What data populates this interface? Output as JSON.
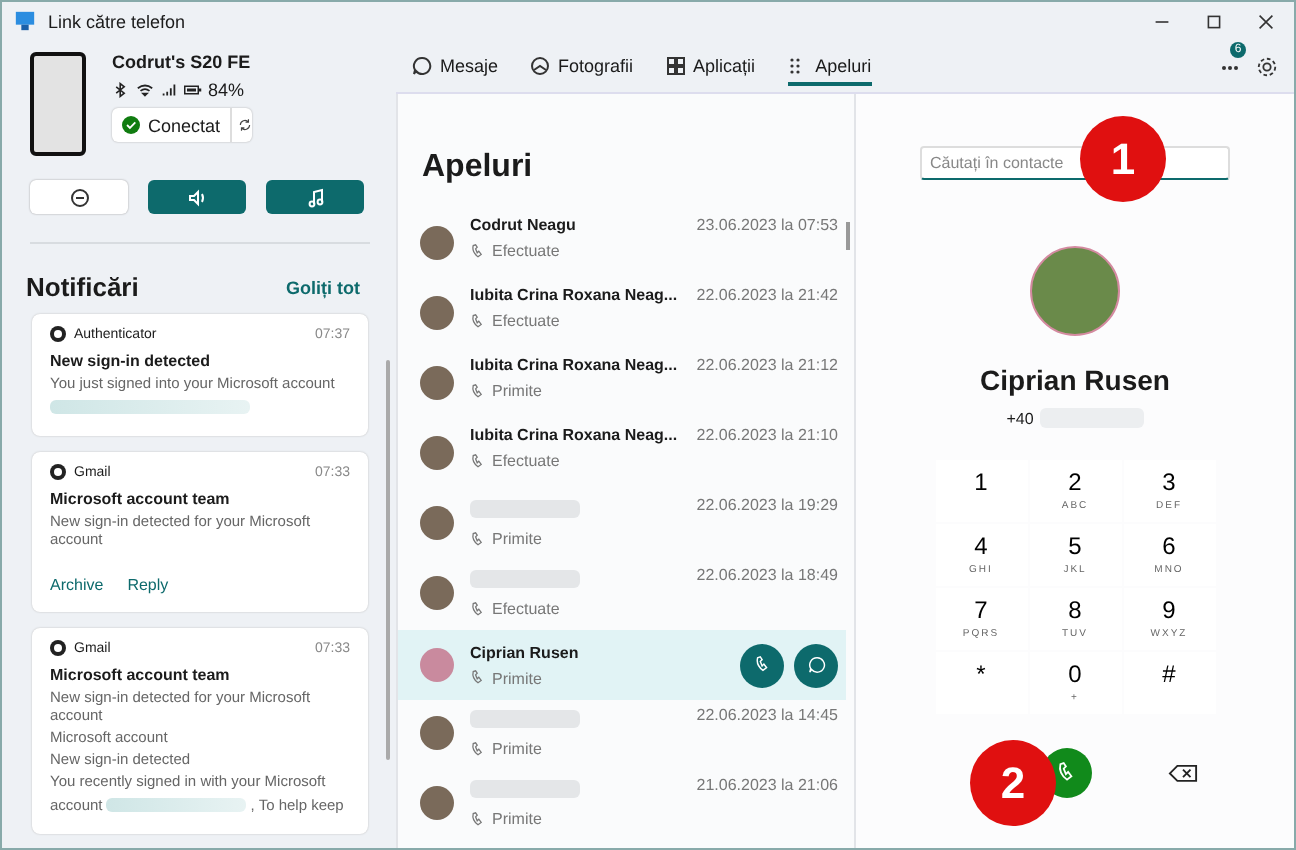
{
  "window": {
    "title": "Link către telefon"
  },
  "phone": {
    "name": "Codrut's S20 FE",
    "battery": "84%",
    "status": "Conectat"
  },
  "notifications": {
    "title": "Notificări",
    "clear": "Goliți tot",
    "cards": [
      {
        "app": "Authenticator",
        "time": "07:37",
        "title": "New sign-in detected",
        "body": [
          "You just signed into your Microsoft account"
        ],
        "redacted": true
      },
      {
        "app": "Gmail",
        "time": "07:33",
        "title": "Microsoft account team",
        "body": [
          "New sign-in detected for your Microsoft account"
        ],
        "redacted": false,
        "actions": [
          "Archive",
          "Reply"
        ]
      },
      {
        "app": "Gmail",
        "time": "07:33",
        "title": "Microsoft account team",
        "body": [
          "New sign-in detected for your Microsoft account",
          "Microsoft account",
          "New sign-in detected",
          "You recently signed in with your Microsoft"
        ],
        "redacted": false,
        "tail": {
          "before": "account",
          "after": ", To help keep"
        }
      }
    ]
  },
  "tabs": [
    {
      "label": "Mesaje",
      "selected": false
    },
    {
      "label": "Fotografii",
      "selected": false
    },
    {
      "label": "Aplicații",
      "selected": false
    },
    {
      "label": "Apeluri",
      "selected": true
    }
  ],
  "badge": "6",
  "calls": {
    "title": "Apeluri",
    "rows": [
      {
        "name": "Codrut Neagu",
        "direction": "Efectuate",
        "date": "23.06.2023 la 07:53",
        "selected": false
      },
      {
        "name": "Iubita Crina Roxana Neag...",
        "direction": "Efectuate",
        "date": "22.06.2023 la 21:42",
        "selected": false
      },
      {
        "name": "Iubita Crina Roxana Neag...",
        "direction": "Primite",
        "date": "22.06.2023 la 21:12",
        "selected": false
      },
      {
        "name": "Iubita Crina Roxana Neag...",
        "direction": "Efectuate",
        "date": "22.06.2023 la 21:10",
        "selected": false
      },
      {
        "direction": "Primite",
        "date": "22.06.2023 la 19:29",
        "selected": false
      },
      {
        "direction": "Efectuate",
        "date": "22.06.2023 la 18:49",
        "selected": false
      },
      {
        "name": "Ciprian Rusen",
        "direction": "Primite",
        "selected": true
      },
      {
        "direction": "Primite",
        "date": "22.06.2023 la 14:45",
        "selected": false
      },
      {
        "direction": "Primite",
        "date": "21.06.2023 la 21:06",
        "selected": false
      }
    ]
  },
  "dialer": {
    "search": {
      "placeholder": "Căutați în contacte"
    },
    "contact": "Ciprian Rusen",
    "number_prefix": "+40",
    "keys": [
      {
        "digit": "1"
      },
      {
        "digit": "2",
        "letters": "ABC"
      },
      {
        "digit": "3",
        "letters": "DEF"
      },
      {
        "digit": "4",
        "letters": "GHI"
      },
      {
        "digit": "5",
        "letters": "JKL"
      },
      {
        "digit": "6",
        "letters": "MNO"
      },
      {
        "digit": "7",
        "letters": "PQRS"
      },
      {
        "digit": "8",
        "letters": "TUV"
      },
      {
        "digit": "9",
        "letters": "WXYZ"
      },
      {
        "digit": "*"
      },
      {
        "digit": "0",
        "letters": "+"
      },
      {
        "digit": "#"
      }
    ]
  },
  "annotations": [
    "1",
    "2"
  ]
}
